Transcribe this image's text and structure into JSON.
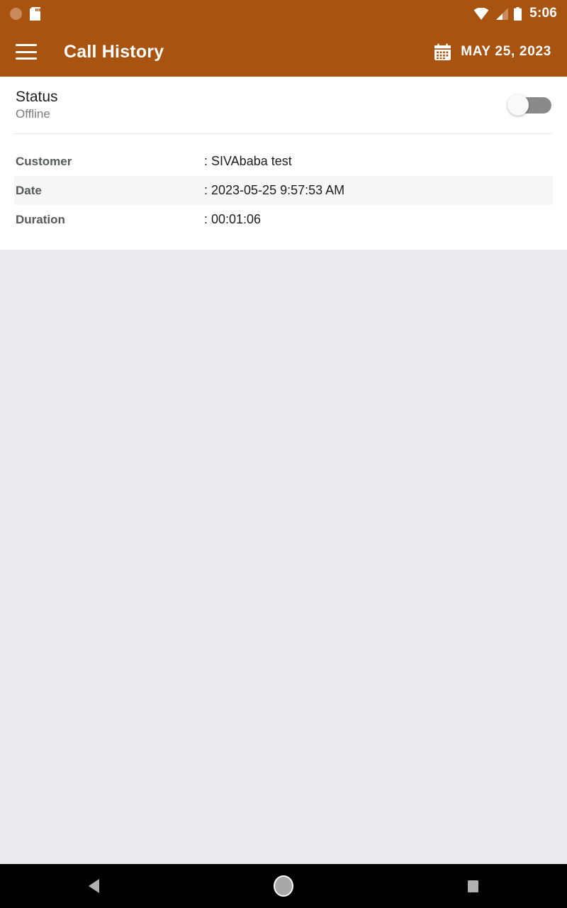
{
  "status_bar": {
    "icons_left": [
      "screen-record-circle-icon",
      "sd-card-icon"
    ],
    "icons_right": [
      "wifi-icon",
      "cellular-signal-icon",
      "battery-icon"
    ],
    "clock": "5:06"
  },
  "app_bar": {
    "menu_icon": "hamburger-menu-icon",
    "title": "Call History",
    "calendar_icon": "calendar-icon",
    "date": "MAY 25, 2023"
  },
  "status_section": {
    "title": "Status",
    "subtitle": "Offline",
    "toggle_state": "off"
  },
  "details": {
    "rows": [
      {
        "label": "Customer",
        "value": ": SIVAbaba test"
      },
      {
        "label": "Date",
        "value": ": 2023-05-25 9:57:53 AM"
      },
      {
        "label": "Duration",
        "value": ": 00:01:06"
      }
    ]
  },
  "nav_bar": {
    "back": "back-nav-icon",
    "home": "home-nav-icon",
    "recents": "recents-nav-icon"
  },
  "colors": {
    "brand": "#a8530f",
    "page_background": "#eae9ee",
    "card": "#ffffff",
    "alt_row": "#f7f7f8",
    "toggle_track": "#8a8a8a",
    "nav_bar": "#000000"
  }
}
